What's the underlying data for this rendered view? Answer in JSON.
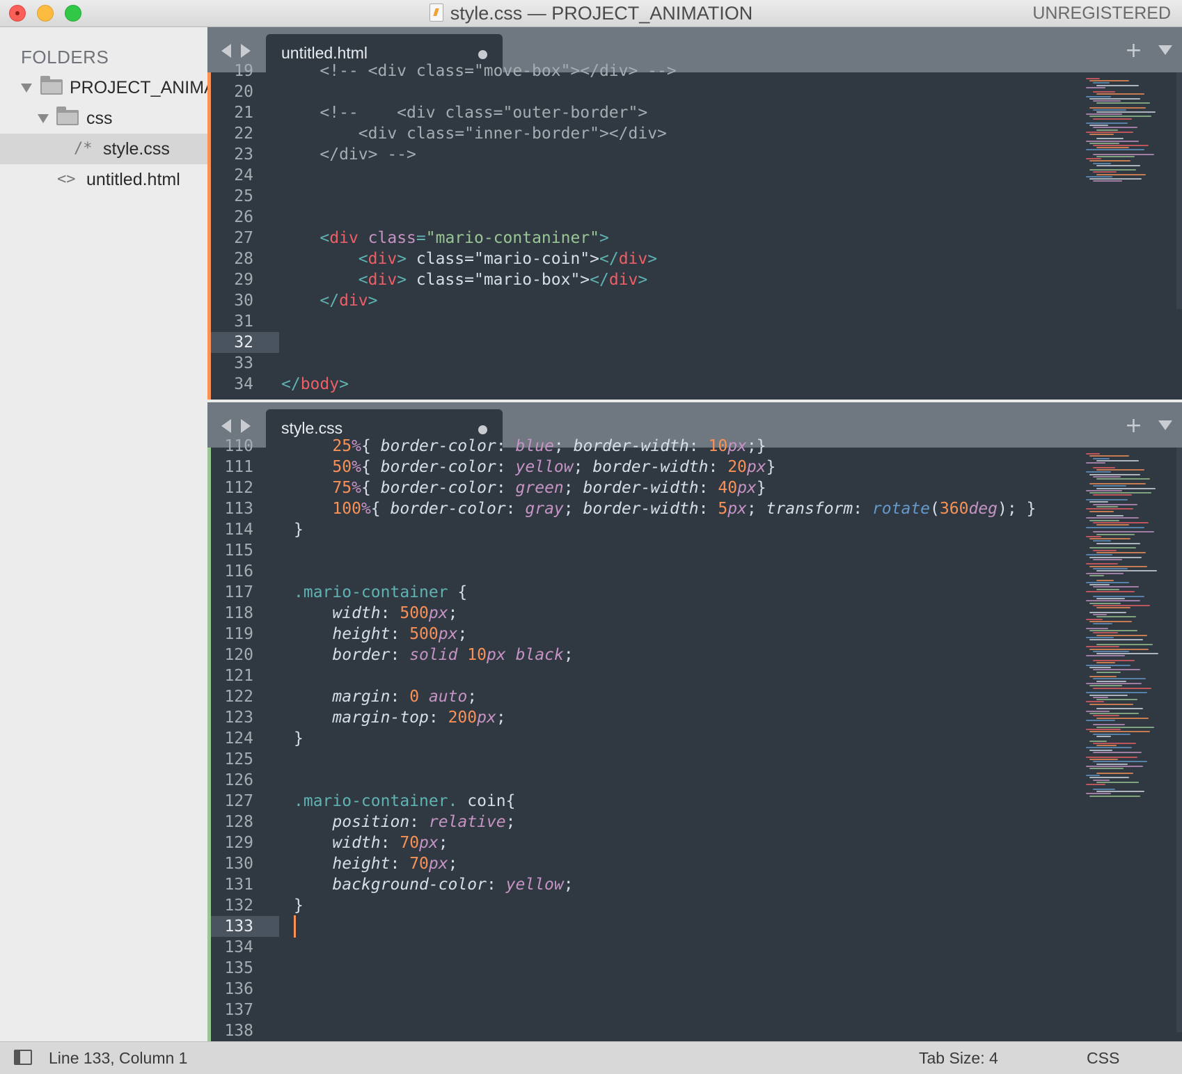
{
  "window": {
    "title": "style.css — PROJECT_ANIMATION",
    "unregistered": "UNREGISTERED"
  },
  "sidebar": {
    "heading": "FOLDERS",
    "items": [
      {
        "label": "PROJECT_ANIMATION",
        "icon": "folder-icon",
        "level": 0
      },
      {
        "label": "css",
        "icon": "folder-icon",
        "level": 1
      },
      {
        "label": "style.css",
        "icon": "css-file-icon",
        "icon_glyph": "/*",
        "level": 2,
        "selected": true
      },
      {
        "label": "untitled.html",
        "icon": "html-file-icon",
        "icon_glyph": "<>",
        "level": 1
      }
    ]
  },
  "panes": [
    {
      "tab": {
        "label": "untitled.html",
        "dirty": true
      },
      "stripe_color": "#f99157",
      "current_line": 32,
      "lines": [
        {
          "n": "19",
          "tokens": [
            [
              "c-comment",
              "    <!-- <div class=\"move-box\"></div> -->"
            ]
          ]
        },
        {
          "n": "20",
          "tokens": []
        },
        {
          "n": "21",
          "tokens": [
            [
              "c-comment",
              "    <!--    <div class=\"outer-border\">"
            ]
          ]
        },
        {
          "n": "22",
          "tokens": [
            [
              "c-comment",
              "        <div class=\"inner-border\"></div>"
            ]
          ]
        },
        {
          "n": "23",
          "tokens": [
            [
              "c-comment",
              "    </div> -->"
            ]
          ]
        },
        {
          "n": "24",
          "tokens": []
        },
        {
          "n": "25",
          "tokens": []
        },
        {
          "n": "26",
          "tokens": []
        },
        {
          "n": "27",
          "tokens": [
            [
              "c-text",
              "    "
            ],
            [
              "c-punc",
              "<"
            ],
            [
              "c-tag",
              "div"
            ],
            [
              "c-text",
              " "
            ],
            [
              "c-attr",
              "class"
            ],
            [
              "c-punc",
              "="
            ],
            [
              "c-str",
              "\"mario-contaniner\""
            ],
            [
              "c-punc",
              ">"
            ]
          ]
        },
        {
          "n": "28",
          "tokens": [
            [
              "c-text",
              "        "
            ],
            [
              "c-punc",
              "<"
            ],
            [
              "c-tag",
              "div"
            ],
            [
              "c-punc",
              ">"
            ],
            [
              "c-text",
              " class=\"mario-coin\">"
            ],
            [
              "c-punc",
              "</"
            ],
            [
              "c-tag",
              "div"
            ],
            [
              "c-punc",
              ">"
            ]
          ]
        },
        {
          "n": "29",
          "tokens": [
            [
              "c-text",
              "        "
            ],
            [
              "c-punc",
              "<"
            ],
            [
              "c-tag",
              "div"
            ],
            [
              "c-punc",
              ">"
            ],
            [
              "c-text",
              " class=\"mario-box\">"
            ],
            [
              "c-punc",
              "</"
            ],
            [
              "c-tag",
              "div"
            ],
            [
              "c-punc",
              ">"
            ]
          ]
        },
        {
          "n": "30",
          "tokens": [
            [
              "c-text",
              "    "
            ],
            [
              "c-punc",
              "</"
            ],
            [
              "c-tag",
              "div"
            ],
            [
              "c-punc",
              ">"
            ]
          ]
        },
        {
          "n": "31",
          "tokens": []
        },
        {
          "n": "32",
          "tokens": []
        },
        {
          "n": "33",
          "tokens": []
        },
        {
          "n": "34",
          "tokens": [
            [
              "c-punc",
              "</"
            ],
            [
              "c-tag",
              "body"
            ],
            [
              "c-punc",
              ">"
            ]
          ]
        }
      ]
    },
    {
      "tab": {
        "label": "style.css",
        "dirty": true
      },
      "stripe_color": "#99c794",
      "current_line": 133,
      "lines": [
        {
          "n": "110",
          "tokens": [
            [
              "c-text",
              "    "
            ],
            [
              "c-num",
              "25"
            ],
            [
              "c-unit",
              "%"
            ],
            [
              "c-text",
              "{ "
            ],
            [
              "c-prop",
              "border-color"
            ],
            [
              "c-text",
              ": "
            ],
            [
              "c-val",
              "blue"
            ],
            [
              "c-text",
              "; "
            ],
            [
              "c-prop",
              "border-width"
            ],
            [
              "c-text",
              ": "
            ],
            [
              "c-num",
              "10"
            ],
            [
              "c-unit",
              "px"
            ],
            [
              "c-text",
              ";}"
            ]
          ]
        },
        {
          "n": "111",
          "tokens": [
            [
              "c-text",
              "    "
            ],
            [
              "c-num",
              "50"
            ],
            [
              "c-unit",
              "%"
            ],
            [
              "c-text",
              "{ "
            ],
            [
              "c-prop",
              "border-color"
            ],
            [
              "c-text",
              ": "
            ],
            [
              "c-val",
              "yellow"
            ],
            [
              "c-text",
              "; "
            ],
            [
              "c-prop",
              "border-width"
            ],
            [
              "c-text",
              ": "
            ],
            [
              "c-num",
              "20"
            ],
            [
              "c-unit",
              "px"
            ],
            [
              "c-text",
              "}"
            ]
          ]
        },
        {
          "n": "112",
          "tokens": [
            [
              "c-text",
              "    "
            ],
            [
              "c-num",
              "75"
            ],
            [
              "c-unit",
              "%"
            ],
            [
              "c-text",
              "{ "
            ],
            [
              "c-prop",
              "border-color"
            ],
            [
              "c-text",
              ": "
            ],
            [
              "c-val",
              "green"
            ],
            [
              "c-text",
              "; "
            ],
            [
              "c-prop",
              "border-width"
            ],
            [
              "c-text",
              ": "
            ],
            [
              "c-num",
              "40"
            ],
            [
              "c-unit",
              "px"
            ],
            [
              "c-text",
              "}"
            ]
          ]
        },
        {
          "n": "113",
          "tokens": [
            [
              "c-text",
              "    "
            ],
            [
              "c-num",
              "100"
            ],
            [
              "c-unit",
              "%"
            ],
            [
              "c-text",
              "{ "
            ],
            [
              "c-prop",
              "border-color"
            ],
            [
              "c-text",
              ": "
            ],
            [
              "c-val",
              "gray"
            ],
            [
              "c-text",
              "; "
            ],
            [
              "c-prop",
              "border-width"
            ],
            [
              "c-text",
              ": "
            ],
            [
              "c-num",
              "5"
            ],
            [
              "c-unit",
              "px"
            ],
            [
              "c-text",
              "; "
            ],
            [
              "c-prop",
              "transform"
            ],
            [
              "c-text",
              ": "
            ],
            [
              "c-fn",
              "rotate"
            ],
            [
              "c-text",
              "("
            ],
            [
              "c-num",
              "360"
            ],
            [
              "c-unit",
              "deg"
            ],
            [
              "c-text",
              "); }"
            ]
          ]
        },
        {
          "n": "114",
          "tokens": [
            [
              "c-text",
              "}"
            ]
          ]
        },
        {
          "n": "115",
          "tokens": []
        },
        {
          "n": "116",
          "tokens": []
        },
        {
          "n": "117",
          "tokens": [
            [
              "c-sel",
              ".mario-container"
            ],
            [
              "c-text",
              " {"
            ]
          ]
        },
        {
          "n": "118",
          "tokens": [
            [
              "c-text",
              "    "
            ],
            [
              "c-prop",
              "width"
            ],
            [
              "c-text",
              ": "
            ],
            [
              "c-num",
              "500"
            ],
            [
              "c-unit",
              "px"
            ],
            [
              "c-text",
              ";"
            ]
          ]
        },
        {
          "n": "119",
          "tokens": [
            [
              "c-text",
              "    "
            ],
            [
              "c-prop",
              "height"
            ],
            [
              "c-text",
              ": "
            ],
            [
              "c-num",
              "500"
            ],
            [
              "c-unit",
              "px"
            ],
            [
              "c-text",
              ";"
            ]
          ]
        },
        {
          "n": "120",
          "tokens": [
            [
              "c-text",
              "    "
            ],
            [
              "c-prop",
              "border"
            ],
            [
              "c-text",
              ": "
            ],
            [
              "c-val",
              "solid"
            ],
            [
              "c-text",
              " "
            ],
            [
              "c-num",
              "10"
            ],
            [
              "c-unit",
              "px"
            ],
            [
              "c-text",
              " "
            ],
            [
              "c-val",
              "black"
            ],
            [
              "c-text",
              ";"
            ]
          ]
        },
        {
          "n": "121",
          "tokens": []
        },
        {
          "n": "122",
          "tokens": [
            [
              "c-text",
              "    "
            ],
            [
              "c-prop",
              "margin"
            ],
            [
              "c-text",
              ": "
            ],
            [
              "c-num",
              "0"
            ],
            [
              "c-text",
              " "
            ],
            [
              "c-val",
              "auto"
            ],
            [
              "c-text",
              ";"
            ]
          ]
        },
        {
          "n": "123",
          "tokens": [
            [
              "c-text",
              "    "
            ],
            [
              "c-prop",
              "margin-top"
            ],
            [
              "c-text",
              ": "
            ],
            [
              "c-num",
              "200"
            ],
            [
              "c-unit",
              "px"
            ],
            [
              "c-text",
              ";"
            ]
          ]
        },
        {
          "n": "124",
          "tokens": [
            [
              "c-text",
              "}"
            ]
          ]
        },
        {
          "n": "125",
          "tokens": []
        },
        {
          "n": "126",
          "tokens": []
        },
        {
          "n": "127",
          "tokens": [
            [
              "c-sel",
              ".mario-container."
            ],
            [
              "c-text",
              " coin{"
            ]
          ]
        },
        {
          "n": "128",
          "tokens": [
            [
              "c-text",
              "    "
            ],
            [
              "c-prop",
              "position"
            ],
            [
              "c-text",
              ": "
            ],
            [
              "c-val",
              "relative"
            ],
            [
              "c-text",
              ";"
            ]
          ]
        },
        {
          "n": "129",
          "tokens": [
            [
              "c-text",
              "    "
            ],
            [
              "c-prop",
              "width"
            ],
            [
              "c-text",
              ": "
            ],
            [
              "c-num",
              "70"
            ],
            [
              "c-unit",
              "px"
            ],
            [
              "c-text",
              ";"
            ]
          ]
        },
        {
          "n": "130",
          "tokens": [
            [
              "c-text",
              "    "
            ],
            [
              "c-prop",
              "height"
            ],
            [
              "c-text",
              ": "
            ],
            [
              "c-num",
              "70"
            ],
            [
              "c-unit",
              "px"
            ],
            [
              "c-text",
              ";"
            ]
          ]
        },
        {
          "n": "131",
          "tokens": [
            [
              "c-text",
              "    "
            ],
            [
              "c-prop",
              "background-color"
            ],
            [
              "c-text",
              ": "
            ],
            [
              "c-val",
              "yellow"
            ],
            [
              "c-text",
              ";"
            ]
          ]
        },
        {
          "n": "132",
          "tokens": [
            [
              "c-text",
              "}"
            ]
          ]
        },
        {
          "n": "133",
          "tokens": []
        },
        {
          "n": "134",
          "tokens": []
        },
        {
          "n": "135",
          "tokens": []
        },
        {
          "n": "136",
          "tokens": []
        },
        {
          "n": "137",
          "tokens": []
        },
        {
          "n": "138",
          "tokens": []
        }
      ]
    }
  ],
  "status": {
    "position": "Line 133, Column 1",
    "tab_size": "Tab Size: 4",
    "syntax": "CSS"
  }
}
